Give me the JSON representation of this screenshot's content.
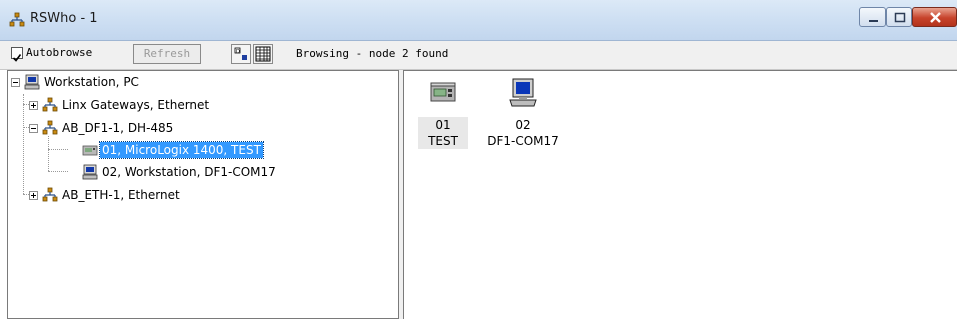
{
  "window": {
    "title": "RSWho - 1"
  },
  "toolbar": {
    "autobrowse_label": "Autobrowse",
    "autobrowse_checked": true,
    "refresh_label": "Refresh",
    "status": "Browsing - node 2 found"
  },
  "tree": {
    "root": {
      "label": "Workstation, PC",
      "icon": "workstation-icon"
    },
    "items": [
      {
        "label": "Linx Gateways, Ethernet",
        "icon": "network-icon",
        "expander": "+"
      },
      {
        "label": "AB_DF1-1, DH-485",
        "icon": "network-icon",
        "expander": "-"
      },
      {
        "label": "01, MicroLogix 1400, TEST",
        "icon": "plc-icon",
        "selected": true
      },
      {
        "label": "02, Workstation, DF1-COM17",
        "icon": "workstation-icon"
      },
      {
        "label": "AB_ETH-1, Ethernet",
        "icon": "network-icon",
        "expander": "+"
      }
    ]
  },
  "devices": [
    {
      "line1": "01",
      "line2": "TEST",
      "icon": "plc-icon"
    },
    {
      "line1": "02",
      "line2": "DF1-COM17",
      "icon": "computer-icon"
    }
  ]
}
